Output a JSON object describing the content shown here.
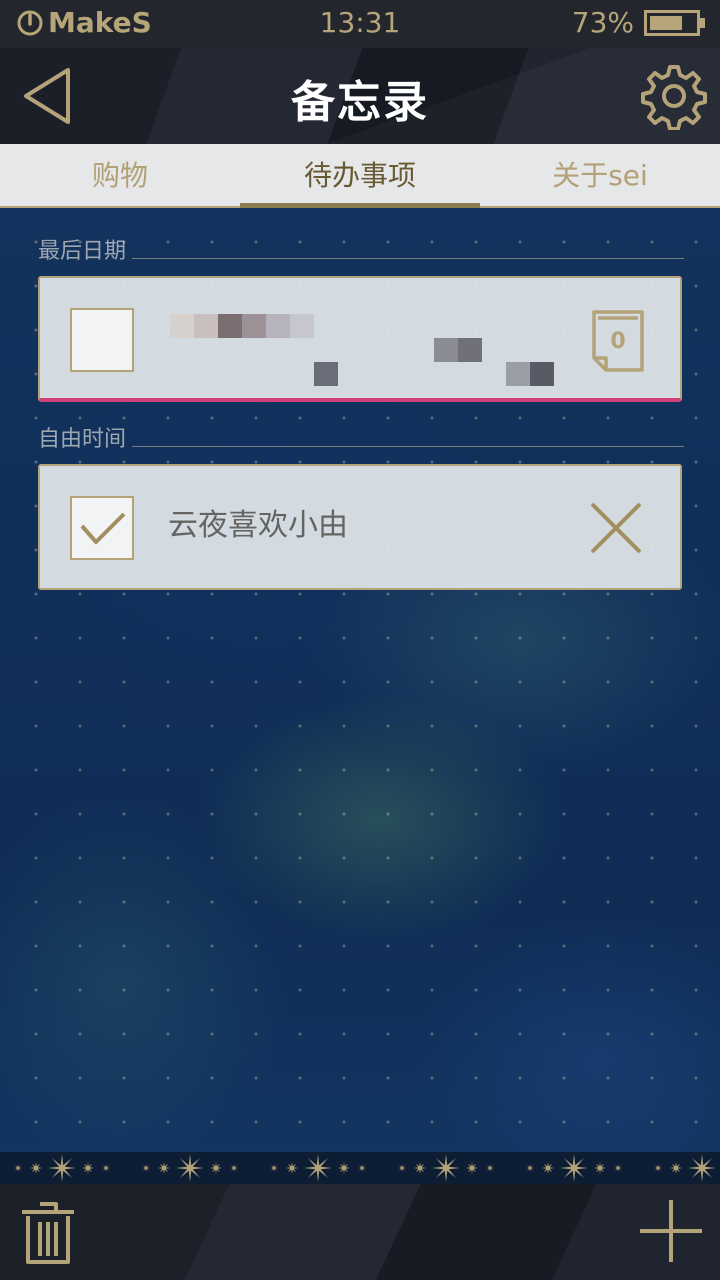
{
  "status_bar": {
    "carrier": "MakeS",
    "time": "13:31",
    "battery_percent": "73%",
    "battery_level": 0.73
  },
  "header": {
    "title": "备忘录",
    "back_icon": "back-triangle-icon",
    "settings_icon": "gear-icon"
  },
  "tabs": [
    {
      "label": "购物",
      "active": false
    },
    {
      "label": "待办事项",
      "active": true
    },
    {
      "label": "关于sei",
      "active": false
    }
  ],
  "sections": {
    "deadline": {
      "label": "最后日期",
      "item": {
        "text": "",
        "checked": false,
        "days_left": "0"
      }
    },
    "free_time": {
      "label": "自由时间",
      "item": {
        "text": "云夜喜欢小由",
        "checked": true
      }
    }
  },
  "bottom_bar": {
    "delete_icon": "trash-icon",
    "add_icon": "plus-icon"
  },
  "colors": {
    "accent_gold": "#b4a278",
    "deadline_line": "#d2407a",
    "tab_bar": "#e6e7e8",
    "top_bar": "#23262d"
  }
}
